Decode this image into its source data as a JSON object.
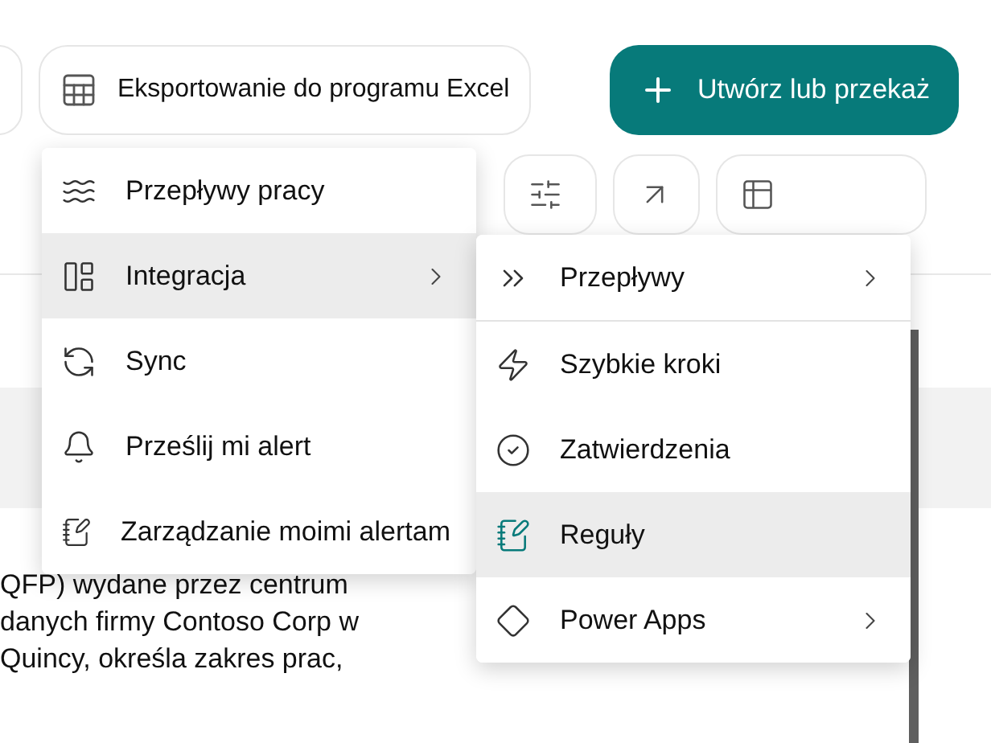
{
  "toolbar": {
    "export_button": {
      "label": "Eksportowanie do programu Excel"
    },
    "create_button": {
      "label": "Utwórz lub przekaż"
    }
  },
  "document": {
    "lines": [
      "QFP) wydane przez centrum",
      "danych firmy Contoso Corp w",
      "Quincy, określa zakres prac,"
    ]
  },
  "menu": {
    "items": [
      {
        "label": "Przepływy pracy",
        "selected": false,
        "has_submenu": false
      },
      {
        "label": "Integracja",
        "selected": true,
        "has_submenu": true
      },
      {
        "label": "Sync",
        "selected": false,
        "has_submenu": false
      },
      {
        "label": "Prześlij mi alert",
        "selected": false,
        "has_submenu": false
      },
      {
        "label": "Zarządzanie moimi alertam",
        "selected": false,
        "has_submenu": false
      }
    ]
  },
  "submenu": {
    "items": [
      {
        "label": "Przepływy",
        "selected": false,
        "has_submenu": true,
        "divider_after": true
      },
      {
        "label": "Szybkie kroki",
        "selected": false,
        "has_submenu": false,
        "divider_after": false
      },
      {
        "label": "Zatwierdzenia",
        "selected": false,
        "has_submenu": false,
        "divider_after": false
      },
      {
        "label": "Reguły",
        "selected": true,
        "has_submenu": false,
        "divider_after": false
      },
      {
        "label": "Power Apps",
        "selected": false,
        "has_submenu": true,
        "divider_after": false
      }
    ]
  }
}
